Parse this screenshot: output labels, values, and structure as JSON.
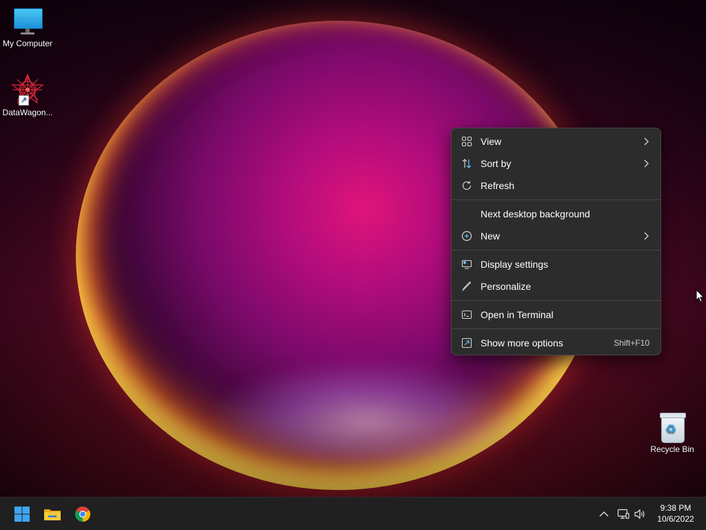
{
  "desktop": {
    "icons": [
      {
        "label": "My Computer"
      },
      {
        "label": "DataWagon..."
      },
      {
        "label": "Recycle Bin"
      }
    ]
  },
  "context_menu": {
    "items": [
      {
        "label": "View",
        "icon": "grid-icon"
      },
      {
        "label": "Sort by",
        "icon": "sort-arrows-icon"
      },
      {
        "label": "Refresh",
        "icon": "refresh-icon"
      },
      {
        "label": "Next desktop background"
      },
      {
        "label": "New",
        "icon": "plus-circle-icon"
      },
      {
        "label": "Display settings",
        "icon": "display-icon"
      },
      {
        "label": "Personalize",
        "icon": "pen-icon"
      },
      {
        "label": "Open in Terminal",
        "icon": "terminal-icon"
      },
      {
        "label": "Show more options",
        "icon": "expand-icon",
        "shortcut": "Shift+F10"
      }
    ]
  },
  "taskbar": {
    "pinned": [
      {
        "name": "Start",
        "icon": "windows-start-icon"
      },
      {
        "name": "File Explorer",
        "icon": "folder-icon"
      },
      {
        "name": "Google Chrome",
        "icon": "chrome-icon"
      }
    ],
    "tray": {
      "icons": [
        "chevron-up-icon",
        "network-icon",
        "volume-icon"
      ],
      "time": "9:38 PM",
      "date": "10/6/2022"
    }
  },
  "colors": {
    "menu_bg": "#2c2c2c",
    "menu_border": "#474747",
    "taskbar_bg": "#202020",
    "accent": "#60cdff"
  }
}
